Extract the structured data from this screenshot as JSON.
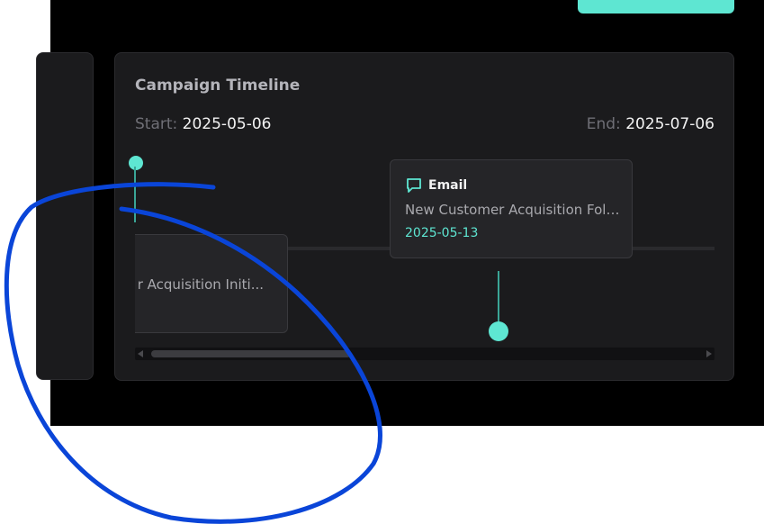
{
  "timeline": {
    "title": "Campaign Timeline",
    "start_label": "Start:",
    "start_date": "2025-05-06",
    "end_label": "End:",
    "end_date": "2025-07-06"
  },
  "events": [
    {
      "type": "",
      "title": "New Customer Acquisition Initi...",
      "visible_title": "r Acquisition Initi...",
      "date": ""
    },
    {
      "type": "Email",
      "title": "New Customer Acquisition Foll...",
      "date": "2025-05-13",
      "icon": "chat-bubble-icon"
    }
  ],
  "colors": {
    "accent": "#5ee6d2",
    "panel": "#1b1b1d",
    "card": "#252528",
    "annotation": "#0a45d8"
  }
}
